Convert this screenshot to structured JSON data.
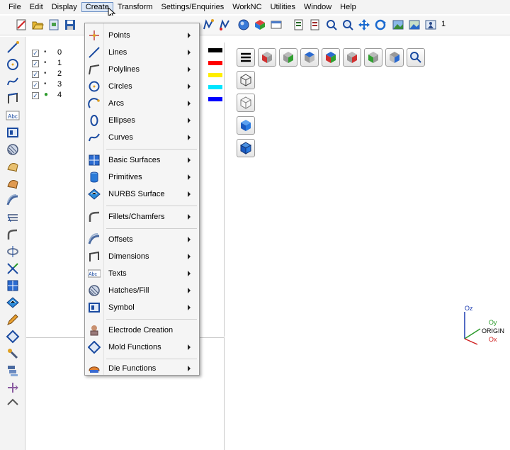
{
  "menubar": {
    "items": [
      "File",
      "Edit",
      "Display",
      "Create",
      "Transform",
      "Settings/Enquiries",
      "WorkNC",
      "Utilities",
      "Window",
      "Help"
    ],
    "active": "Create"
  },
  "toolbar": {
    "field_value": "1"
  },
  "layers": [
    {
      "checked": "✓",
      "marker": "•",
      "number": "0",
      "color": "#000000"
    },
    {
      "checked": "✓",
      "marker": "•",
      "number": "1",
      "color": "#ff0000"
    },
    {
      "checked": "✓",
      "marker": "•",
      "number": "2",
      "color": "#ffee00"
    },
    {
      "checked": "✓",
      "marker": "•",
      "number": "3",
      "color": "#00e5ff"
    },
    {
      "checked": "✓",
      "marker": "●",
      "number": "4",
      "color": "#0000ff"
    }
  ],
  "create_menu": {
    "items": [
      {
        "label": "Points",
        "icon": "point-icon",
        "submenu": true
      },
      {
        "label": "Lines",
        "icon": "line-icon",
        "submenu": true
      },
      {
        "label": "Polylines",
        "icon": "polyline-icon",
        "submenu": true
      },
      {
        "label": "Circles",
        "icon": "circle-icon",
        "submenu": true
      },
      {
        "label": "Arcs",
        "icon": "arc-icon",
        "submenu": true
      },
      {
        "label": "Ellipses",
        "icon": "ellipse-icon",
        "submenu": true
      },
      {
        "label": "Curves",
        "icon": "curve-icon",
        "submenu": true
      },
      {
        "label": "Basic Surfaces",
        "icon": "basic-surface-icon",
        "submenu": true
      },
      {
        "label": "Primitives",
        "icon": "primitive-icon",
        "submenu": true
      },
      {
        "label": "NURBS Surface",
        "icon": "nurbs-surface-icon",
        "submenu": true
      },
      {
        "label": "Fillets/Chamfers",
        "icon": "fillet-icon",
        "submenu": true
      },
      {
        "label": "Offsets",
        "icon": "offset-icon",
        "submenu": true
      },
      {
        "label": "Dimensions",
        "icon": "dimension-icon",
        "submenu": true
      },
      {
        "label": "Texts",
        "icon": "text-icon",
        "submenu": true
      },
      {
        "label": "Hatches/Fill",
        "icon": "hatch-icon",
        "submenu": true
      },
      {
        "label": "Symbol",
        "icon": "symbol-icon",
        "submenu": true
      },
      {
        "label": "Electrode Creation",
        "icon": "electrode-icon",
        "submenu": false
      },
      {
        "label": "Mold Functions",
        "icon": "mold-icon",
        "submenu": true
      },
      {
        "label": "Die Functions",
        "icon": "die-icon",
        "submenu": true
      }
    ]
  },
  "axis": {
    "z": "Oz",
    "y": "Oy",
    "origin": "ORIGIN",
    "x": "Ox"
  },
  "colors": {
    "accent": "#2b6cc4",
    "menu_highlight": "#dde8f6"
  }
}
